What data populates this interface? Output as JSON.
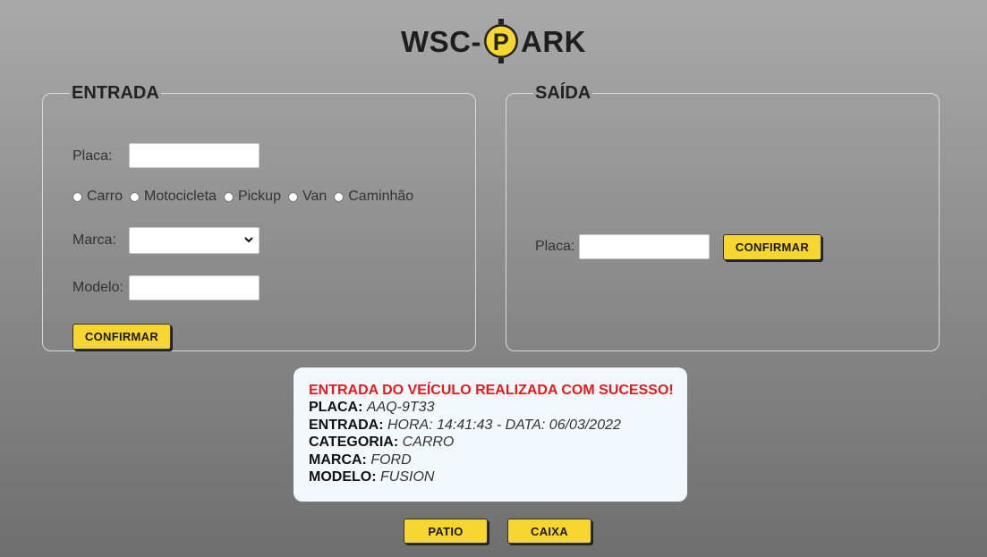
{
  "logo": {
    "prefix": "WSC-",
    "icon_letter": "P",
    "suffix": "ARK"
  },
  "entrada": {
    "legend": "ENTRADA",
    "placa_label": "Placa:",
    "placa_value": "",
    "categories": [
      "Carro",
      "Motocicleta",
      "Pickup",
      "Van",
      "Caminhão"
    ],
    "marca_label": "Marca:",
    "marca_value": "",
    "modelo_label": "Modelo:",
    "modelo_value": "",
    "confirm_label": "CONFIRMAR"
  },
  "saida": {
    "legend": "SAÍDA",
    "placa_label": "Placa:",
    "placa_value": "",
    "confirm_label": "CONFIRMAR"
  },
  "message": {
    "title": "ENTRADA DO VEÍCULO REALIZADA COM SUCESSO!",
    "placa_label": "PLACA:",
    "placa_value": "AAQ-9T33",
    "entrada_label": "ENTRADA:",
    "entrada_value": "HORA: 14:41:43 - DATA: 06/03/2022",
    "categoria_label": "CATEGORIA:",
    "categoria_value": "CARRO",
    "marca_label": "MARCA:",
    "marca_value": "FORD",
    "modelo_label": "MODELO:",
    "modelo_value": "FUSION"
  },
  "footer": {
    "patio_label": "PATIO",
    "caixa_label": "CAIXA"
  },
  "colors": {
    "accent": "#f7d631",
    "success_title": "#e01b1b",
    "message_bg": "#f3f8fc"
  },
  "icons": {
    "logo": "parking-sign-icon",
    "select": "chevron-down-icon"
  }
}
